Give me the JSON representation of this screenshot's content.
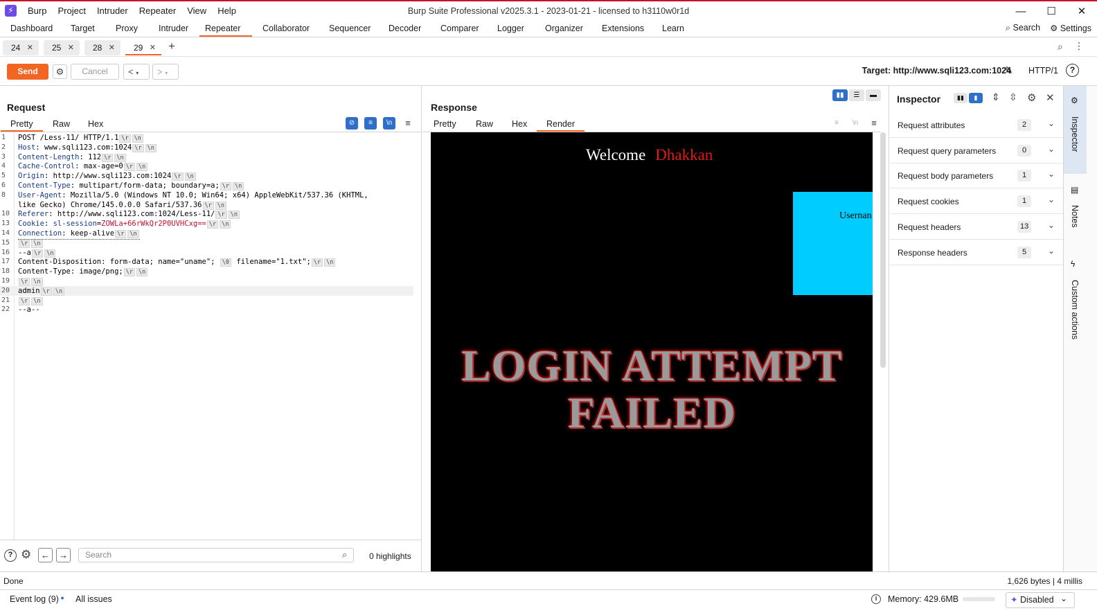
{
  "window": {
    "title": "Burp Suite Professional v2025.3.1 - 2023-01-21 - licensed to h3110w0r1d",
    "menu": [
      "Burp",
      "Project",
      "Intruder",
      "Repeater",
      "View",
      "Help"
    ]
  },
  "main_tabs": [
    "Dashboard",
    "Target",
    "Proxy",
    "Intruder",
    "Repeater",
    "Collaborator",
    "Sequencer",
    "Decoder",
    "Comparer",
    "Logger",
    "Organizer",
    "Extensions",
    "Learn"
  ],
  "main_tab_active": "Repeater",
  "top_right": {
    "search": "Search",
    "settings": "Settings"
  },
  "repeater_tabs": [
    "24",
    "25",
    "28",
    "29"
  ],
  "repeater_tab_active": "29",
  "toolbar": {
    "send": "Send",
    "cancel": "Cancel",
    "target": "Target: http://www.sqli123.com:1024",
    "http": "HTTP/1"
  },
  "request": {
    "title": "Request",
    "tabs": [
      "Pretty",
      "Raw",
      "Hex"
    ],
    "active_tab": "Pretty",
    "lines": [
      {
        "n": "1",
        "key": "",
        "val": "POST /Less-11/ HTTP/1.1"
      },
      {
        "n": "2",
        "key": "Host",
        "val": "www.sqli123.com:1024"
      },
      {
        "n": "3",
        "key": "Content-Length",
        "val": "112"
      },
      {
        "n": "4",
        "key": "Cache-Control",
        "val": "max-age=0"
      },
      {
        "n": "5",
        "key": "Origin",
        "val": "http://www.sqli123.com:1024"
      },
      {
        "n": "6",
        "key": "Content-Type",
        "val": "multipart/form-data; boundary=a;"
      },
      {
        "n": "8",
        "key": "User-Agent",
        "val": "Mozilla/5.0 (Windows NT 10.0; Win64; x64) AppleWebKit/537.36 (KHTML,"
      },
      {
        "n": "",
        "key": "",
        "val": "like Gecko) Chrome/145.0.0.0 Safari/537.36"
      },
      {
        "n": "10",
        "key": "Referer",
        "val": "http://www.sqli123.com:1024/Less-11/"
      },
      {
        "n": "13",
        "key": "Cookie",
        "val": "sl-session=ZOWLa+66rWkQr2P0UVHCxg=="
      },
      {
        "n": "14",
        "key": "Connection",
        "val": "keep-alive"
      },
      {
        "n": "15",
        "key": "",
        "val": ""
      },
      {
        "n": "16",
        "key": "",
        "val": "--a"
      },
      {
        "n": "17",
        "key": "",
        "val": "Content-Disposition: form-data; name=\"uname\";"
      },
      {
        "n": "18",
        "key": "",
        "val": "Content-Type: image/png;"
      },
      {
        "n": "19",
        "key": "",
        "val": ""
      },
      {
        "n": "20",
        "key": "",
        "val": "admin"
      },
      {
        "n": "21",
        "key": "",
        "val": ""
      },
      {
        "n": "22",
        "key": "",
        "val": "--a--"
      }
    ],
    "filename_fragment": "filename=\"1.txt\";",
    "null_token": "\\0",
    "cr_token": "\\r",
    "lf_token": "\\n",
    "search_placeholder": "Search",
    "highlights": "0 highlights"
  },
  "response": {
    "title": "Response",
    "tabs": [
      "Pretty",
      "Raw",
      "Hex",
      "Render"
    ],
    "active_tab": "Render",
    "render": {
      "welcome": "Welcome",
      "user": "Dhakkan",
      "username_label": "Usernan",
      "line1": "LOGIN ATTEMPT",
      "line2": "FAILED"
    }
  },
  "inspector": {
    "title": "Inspector",
    "rows": [
      {
        "label": "Request attributes",
        "count": "2"
      },
      {
        "label": "Request query parameters",
        "count": "0"
      },
      {
        "label": "Request body parameters",
        "count": "1"
      },
      {
        "label": "Request cookies",
        "count": "1"
      },
      {
        "label": "Request headers",
        "count": "13"
      },
      {
        "label": "Response headers",
        "count": "5"
      }
    ]
  },
  "rail": [
    "Inspector",
    "Notes",
    "Custom actions"
  ],
  "status": {
    "left": "Done",
    "right": "1,626 bytes | 4 millis"
  },
  "bottom": {
    "event_log": "Event log (9)",
    "all_issues": "All issues",
    "memory": "Memory: 429.6MB",
    "disabled": "Disabled"
  },
  "colors": {
    "accent": "#f26522",
    "cyan_box": "#00ccff",
    "dhakkan": "#e41818"
  }
}
